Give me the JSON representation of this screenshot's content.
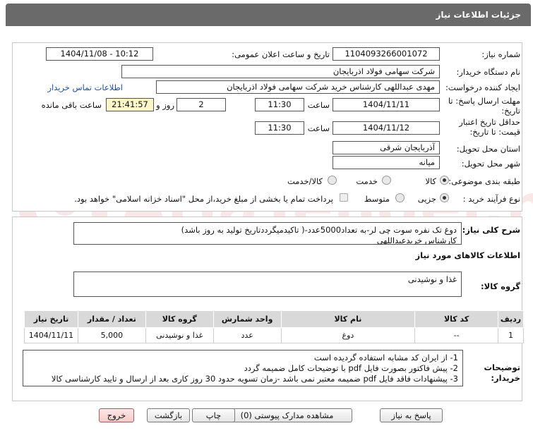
{
  "header": {
    "title": "جزئیات اطلاعات نیاز"
  },
  "labels": {
    "need_number": "شماره نیاز:",
    "announce_datetime": "تاریخ و ساعت اعلان عمومی:",
    "buyer_org": "نام دستگاه خریدار:",
    "requester": "ایجاد کننده درخواست:",
    "reply_deadline": "مهلت ارسال پاسخ: تا تاریخ:",
    "hour": "ساعت",
    "day_and": "روز و",
    "remaining": "ساعت باقی مانده",
    "price_validity": "حداقل تاریخ اعتبار قیمت: تا تاریخ:",
    "hour2": "ساعت",
    "delivery_province": "استان محل تحویل:",
    "delivery_city": "شهر محل تحویل:",
    "category": "طبقه بندی موضوعی:",
    "purchase_process": "نوع فرآیند خرید :",
    "general_desc": "شرح کلی نیاز:",
    "goods_info": "اطلاعات کالاهای مورد نیاز",
    "goods_group": "گروه کالا:",
    "buyer_notes": "توضیحات خریدار:"
  },
  "fields": {
    "need_number": "1104093266001072",
    "announce_datetime": "1404/11/08 - 10:12",
    "buyer_org": "شرکت سهامی فولاد اذربایجان",
    "requester": "مهدی عبداللهی کارشناس خرید شرکت سهامی فولاد اذربایجان",
    "contact_link": "اطلاعات تماس خریدار",
    "reply_date": "1404/11/11",
    "reply_time": "11:30",
    "reply_days": "2",
    "remaining_time": "21:41:57",
    "validity_date": "1404/11/12",
    "validity_time": "11:30",
    "province": "آذربایجان شرقی",
    "city": "میانه"
  },
  "category_options": [
    {
      "label": "کالا",
      "checked": true
    },
    {
      "label": "خدمت",
      "checked": false
    },
    {
      "label": "کالا/خدمت",
      "checked": false
    }
  ],
  "process_options": [
    {
      "label": "جزیی",
      "checked": true
    },
    {
      "label": "متوسط",
      "checked": false
    }
  ],
  "payment_note": "پرداخت تمام یا بخشی از مبلغ خرید،از محل \"اسناد خزانه اسلامی\" خواهد بود.",
  "general_desc_lines": [
    "دوغ تک نفره سوت چی لر-به تعداد5000عدد-( تاکیدمیگرددتاریخ تولید به روز باشد)",
    "کارشناس خریدعبداللهی"
  ],
  "goods_group_value": "غذا و نوشیدنی",
  "table": {
    "headers": [
      "ردیف",
      "کد کالا",
      "نام کالا",
      "واحد شمارش",
      "گروه کالا",
      "تعداد / مقدار",
      "تاریخ نیاز"
    ],
    "rows": [
      [
        "1",
        "--",
        "دوغ",
        "عدد",
        "غذا و نوشیدنی",
        "5,000",
        "1404/11/11"
      ]
    ]
  },
  "buyer_notes_lines": [
    "1- از ایران کد مشابه استفاده گردیده است",
    "2- پیش فاکتور بصورت فایل pdf با توضیحات کامل ضمیمه گردد",
    "3- پیشنهادات فاقد فایل pdf  ضمیمه معتبر نمی باشد -زمان تسویه حدود 30  روز کاری بعد از ارسال و تایید کارشناسی کالا"
  ],
  "buttons": {
    "reply": "پاسخ به نیاز",
    "view_docs": "مشاهده مدارک پیوستی (0)",
    "print": "چاپ",
    "back": "بازگشت",
    "exit": "خروج"
  },
  "watermark_text": "AriaTender.neT",
  "colors": {
    "header": "#6a6a6a",
    "link": "#1a4fb3",
    "remaining_bg": "#fdf6c8",
    "exit_bg": "#f7caca"
  }
}
